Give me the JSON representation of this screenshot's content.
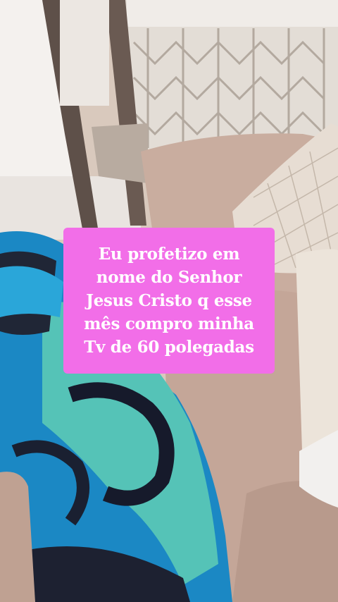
{
  "overlay": {
    "caption": "Eu profetizo em\nnome do Senhor\nJesus Cristo q  esse\nmês compro minha\nTv de 60 polegadas",
    "background_color": "#f26ee8",
    "text_color": "#ffffff"
  }
}
